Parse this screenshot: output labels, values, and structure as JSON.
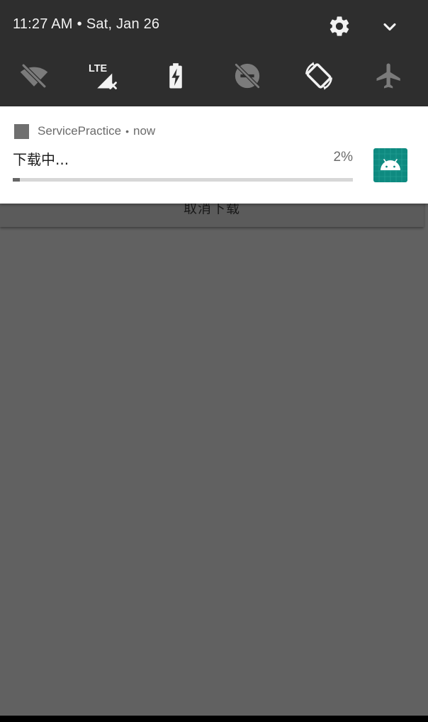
{
  "status_bar": {
    "time": "11:27 AM",
    "separator": "•",
    "date": "Sat, Jan 26",
    "settings_icon": "gear-icon",
    "expand_icon": "chevron-down-icon"
  },
  "quick_settings": {
    "tiles": [
      {
        "name": "wifi-off-icon",
        "state": "off"
      },
      {
        "name": "mobile-data-icon",
        "text": "LTE",
        "state": "on"
      },
      {
        "name": "battery-charging-icon",
        "state": "on"
      },
      {
        "name": "do-not-disturb-off-icon",
        "state": "off"
      },
      {
        "name": "auto-rotate-icon",
        "state": "on"
      },
      {
        "name": "airplane-mode-icon",
        "state": "off"
      }
    ]
  },
  "notification": {
    "app_name": "ServicePractice",
    "separator": "•",
    "time": "now",
    "title": "下载中...",
    "progress_text": "2%",
    "progress": 0.02,
    "large_icon": "android-robot-icon",
    "accent": "#0e8a80"
  },
  "app": {
    "cancel_button_label": "取消下载"
  }
}
